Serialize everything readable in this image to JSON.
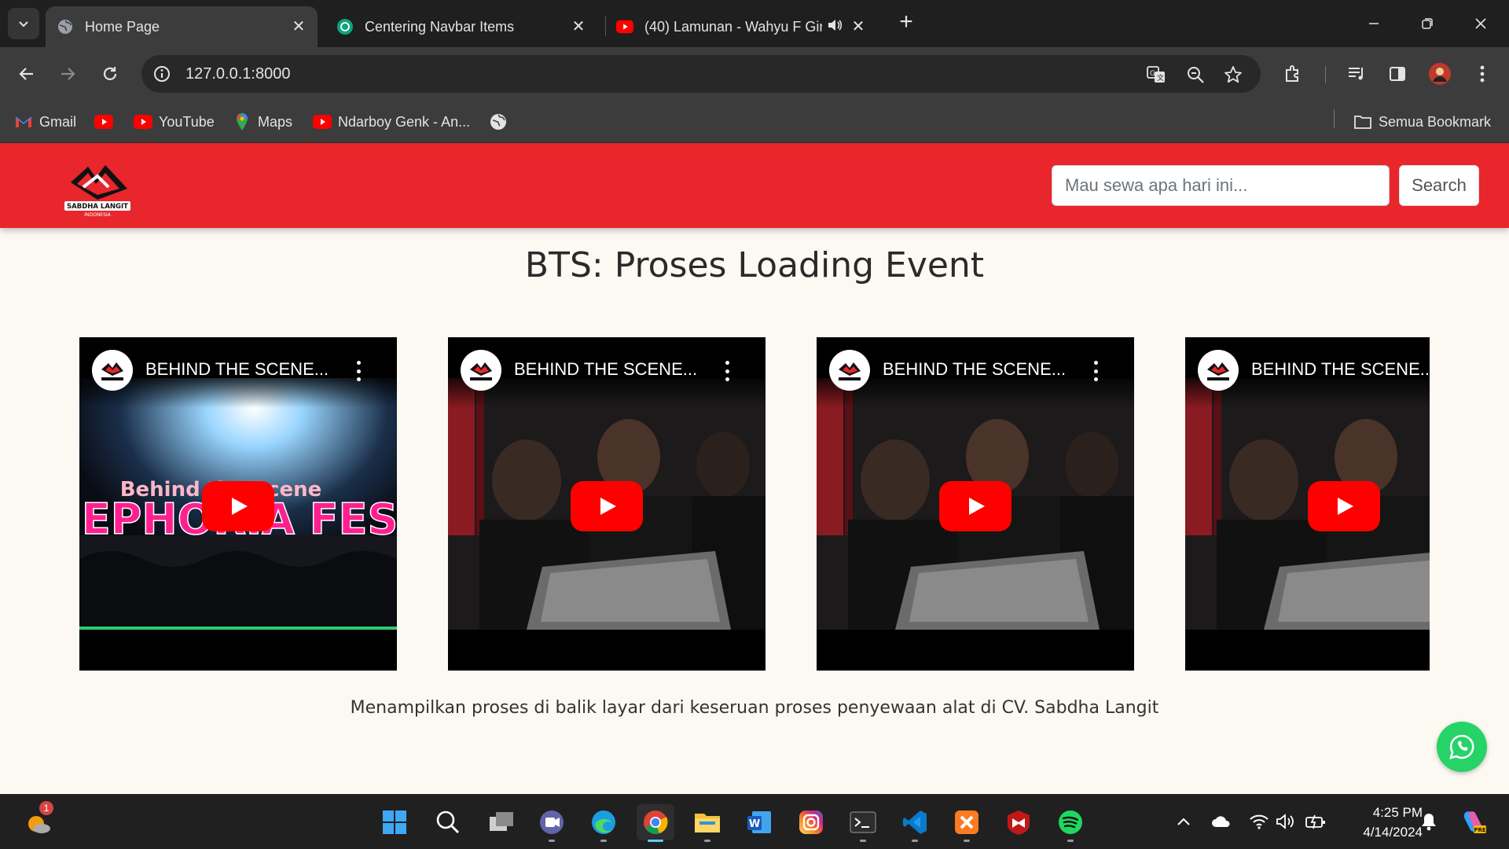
{
  "browser": {
    "tabs": [
      {
        "title": "Home Page",
        "favicon": "globe-icon",
        "active": true
      },
      {
        "title": "Centering Navbar Items",
        "favicon": "chatgpt-icon",
        "active": false
      },
      {
        "title": "(40) Lamunan - Wahyu F Gir",
        "favicon": "youtube-icon",
        "active": false,
        "audio": "speaker-icon"
      }
    ],
    "address": "127.0.0.1:8000",
    "bookmarks": [
      {
        "label": "Gmail",
        "icon": "gmail-icon"
      },
      {
        "label": "",
        "icon": "youtube-icon"
      },
      {
        "label": "YouTube",
        "icon": "youtube-icon"
      },
      {
        "label": "Maps",
        "icon": "maps-icon"
      },
      {
        "label": "Ndarboy Genk - An...",
        "icon": "youtube-icon"
      },
      {
        "label": "",
        "icon": "globe-icon"
      }
    ],
    "all_bookmarks": "Semua Bookmark"
  },
  "page": {
    "brand": {
      "name": "SABDHA LANGIT",
      "sub": "INDONESIA"
    },
    "search": {
      "placeholder": "Mau sewa apa hari ini...",
      "button": "Search"
    },
    "section_title": "BTS: Proses Loading Event",
    "videos": [
      {
        "title": "BEHIND THE SCENE...",
        "thumb": "festival-stage",
        "overlay_top": "Behind the Scene",
        "overlay_main": "BEPHORIA FEST"
      },
      {
        "title": "BEHIND THE SCENE...",
        "thumb": "crew-at-laptop"
      },
      {
        "title": "BEHIND THE SCENE...",
        "thumb": "crew-at-laptop"
      },
      {
        "title": "BEHIND THE SCENE...",
        "thumb": "crew-at-laptop"
      }
    ],
    "caption": "Menampilkan proses di balik layar dari keseruan proses penyewaan alat di CV. Sabdha Langit"
  },
  "taskbar": {
    "weather_badge": "1",
    "apps": [
      "start-icon",
      "search-icon",
      "task-view-icon",
      "teams-icon",
      "edge-icon",
      "chrome-icon",
      "file-explorer-icon",
      "word-icon",
      "instagram-icon",
      "terminal-icon",
      "vscode-icon",
      "xampp-icon",
      "mcafee-icon",
      "spotify-icon"
    ],
    "time": "4:25 PM",
    "date": "4/14/2024"
  },
  "colors": {
    "navbar": "#e8262b",
    "page_bg": "#fcf9f2",
    "whatsapp": "#25d366",
    "youtube_red": "#ff0000"
  }
}
